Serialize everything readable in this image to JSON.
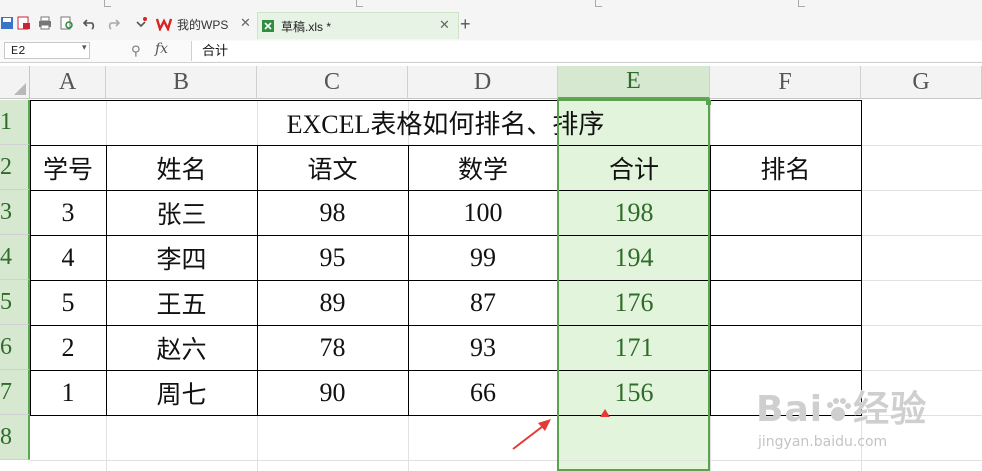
{
  "tabs": [
    {
      "label": "我的WPS"
    },
    {
      "label": "草稿.xls *"
    }
  ],
  "formula_bar": {
    "name_box": "E2",
    "fx": "fx",
    "value": "合计"
  },
  "columns": [
    "A",
    "B",
    "C",
    "D",
    "E",
    "F",
    "G"
  ],
  "rows": [
    "1",
    "2",
    "3",
    "4",
    "5",
    "6",
    "7",
    "8"
  ],
  "sheet": {
    "title": "EXCEL表格如何排名、排序",
    "headers": [
      "学号",
      "姓名",
      "语文",
      "数学",
      "合计",
      "排名"
    ],
    "data": [
      [
        "3",
        "张三",
        "98",
        "100",
        "198",
        ""
      ],
      [
        "4",
        "李四",
        "95",
        "99",
        "194",
        ""
      ],
      [
        "5",
        "王五",
        "89",
        "87",
        "176",
        ""
      ],
      [
        "2",
        "赵六",
        "78",
        "93",
        "171",
        ""
      ],
      [
        "1",
        "周七",
        "90",
        "66",
        "156",
        ""
      ]
    ]
  },
  "selected_column": "E",
  "accent_color": "#5aa24f",
  "watermark": {
    "logo": "Baidu经验",
    "url": "jingyan.baidu.com"
  }
}
